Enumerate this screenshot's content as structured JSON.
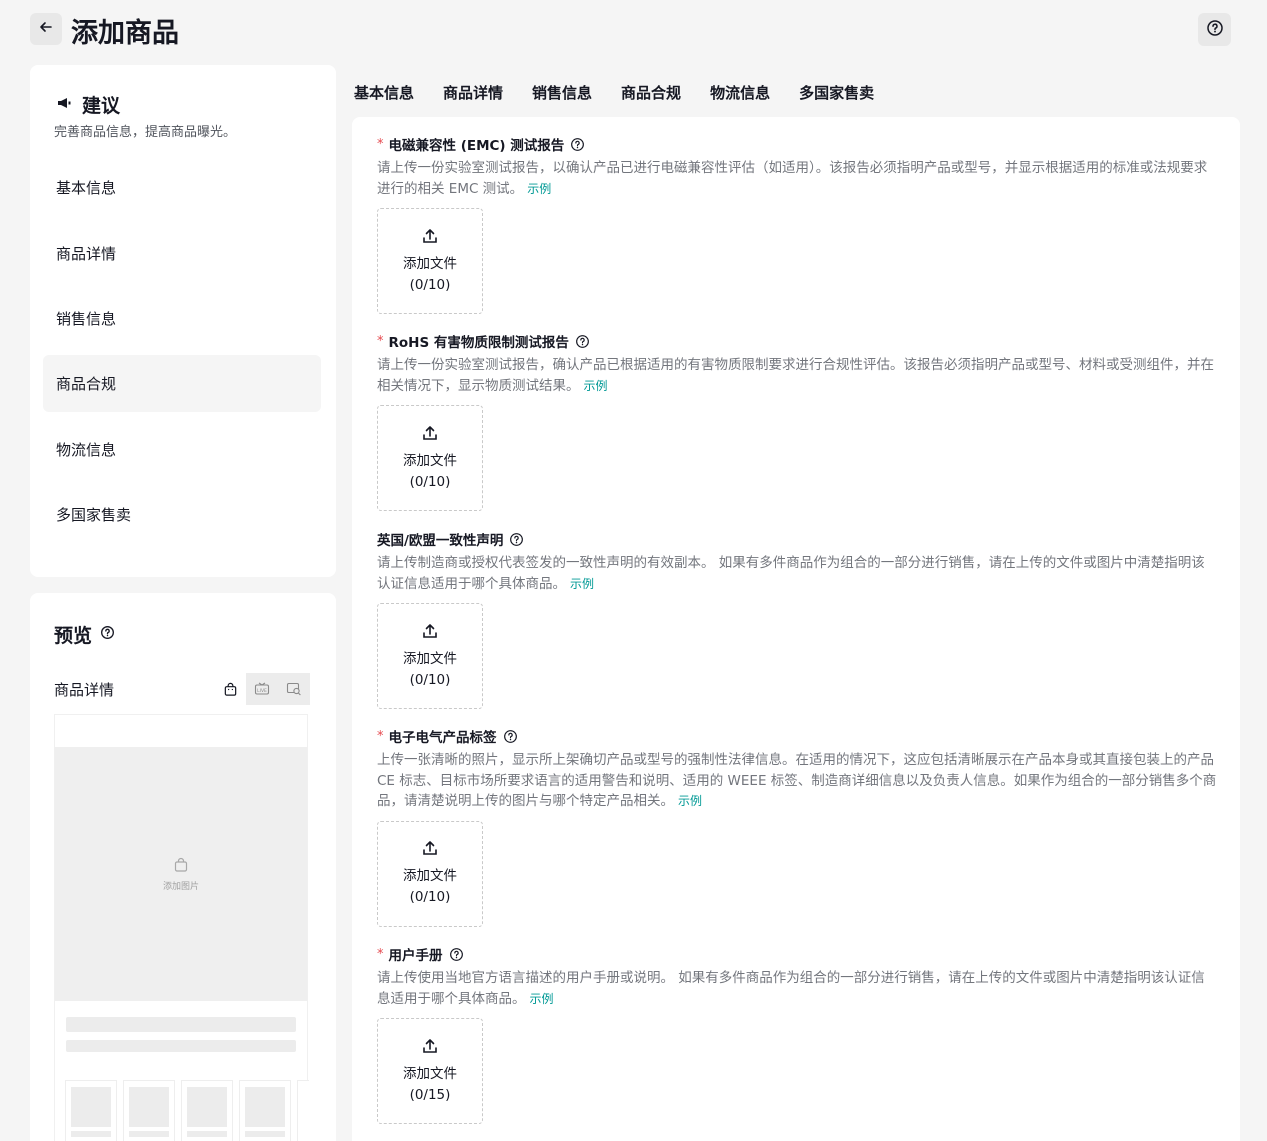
{
  "header": {
    "title": "添加商品"
  },
  "suggestion": {
    "title": "建议",
    "subtitle": "完善商品信息，提高商品曝光。",
    "nav": [
      "基本信息",
      "商品详情",
      "销售信息",
      "商品合规",
      "物流信息",
      "多国家售卖"
    ],
    "active_index": 3
  },
  "preview": {
    "title": "预览",
    "subtitle": "商品详情",
    "image_placeholder": "添加图片"
  },
  "tabs": [
    "基本信息",
    "商品详情",
    "销售信息",
    "商品合规",
    "物流信息",
    "多国家售卖"
  ],
  "active_tab": 3,
  "upload_label": "添加文件",
  "example_label": "示例",
  "fields": [
    {
      "required": true,
      "label": "电磁兼容性 (EMC) 测试报告",
      "desc": "请上传一份实验室测试报告，以确认产品已进行电磁兼容性评估（如适用）。该报告必须指明产品或型号，并显示根据适用的标准或法规要求进行的相关 EMC 测试。",
      "count": "(0/10)"
    },
    {
      "required": true,
      "label": "RoHS 有害物质限制测试报告",
      "desc": "请上传一份实验室测试报告，确认产品已根据适用的有害物质限制要求进行合规性评估。该报告必须指明产品或型号、材料或受测组件，并在相关情况下，显示物质测试结果。",
      "count": "(0/10)"
    },
    {
      "required": false,
      "label": "英国/欧盟一致性声明",
      "desc": "请上传制造商或授权代表签发的一致性声明的有效副本。 如果有多件商品作为组合的一部分进行销售，请在上传的文件或图片中清楚指明该认证信息适用于哪个具体商品。",
      "count": "(0/10)"
    },
    {
      "required": true,
      "label": "电子电气产品标签",
      "desc": "上传一张清晰的照片，显示所上架确切产品或型号的强制性法律信息。在适用的情况下，这应包括清晰展示在产品本身或其直接包装上的产品 CE 标志、目标市场所要求语言的适用警告和说明、适用的 WEEE 标签、制造商详细信息以及负责人信息。如果作为组合的一部分销售多个商品，请清楚说明上传的图片与哪个特定产品相关。",
      "count": "(0/10)"
    },
    {
      "required": true,
      "label": "用户手册",
      "desc": "请上传使用当地官方语言描述的用户手册或说明。 如果有多件商品作为组合的一部分进行销售，请在上传的文件或图片中清楚指明该认证信息适用于哪个具体商品。",
      "count": "(0/15)"
    }
  ]
}
